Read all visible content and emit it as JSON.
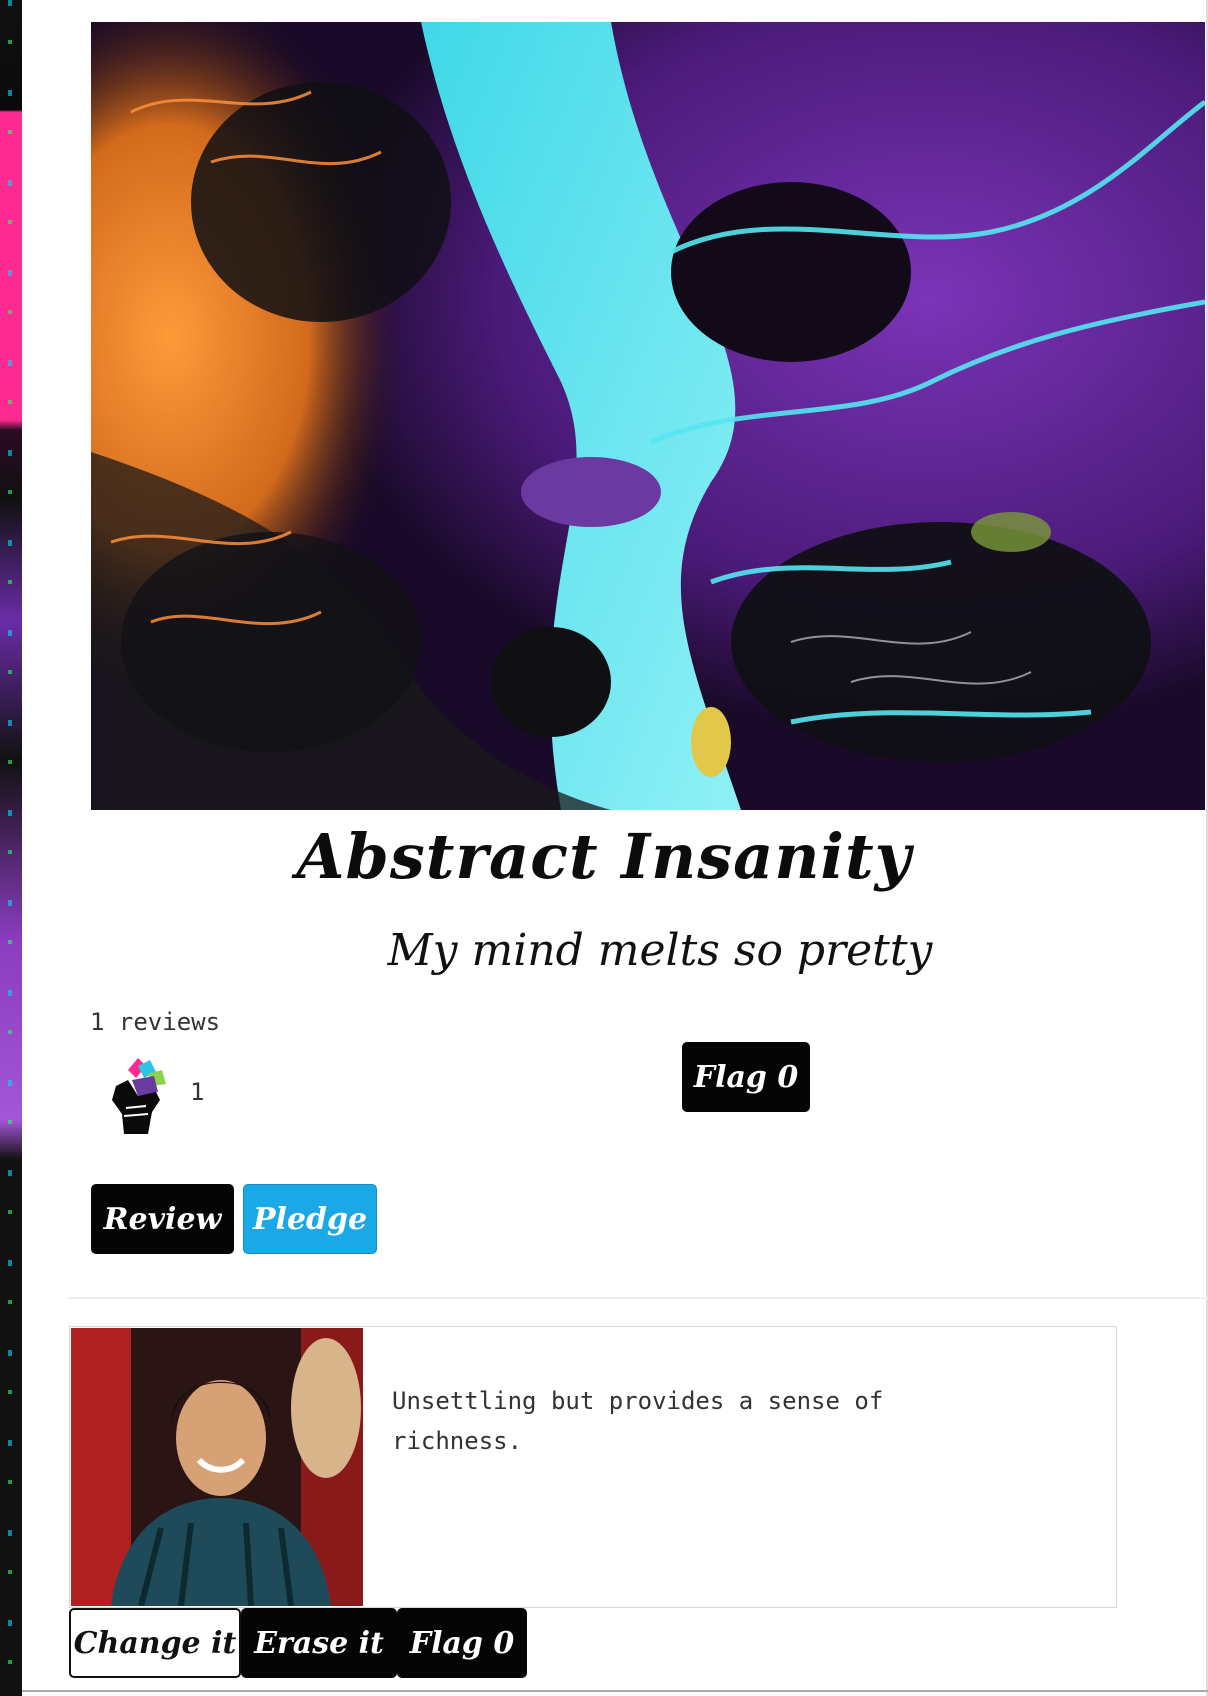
{
  "artwork": {
    "image_icon": "abstract-fluid-painting",
    "title": "Abstract Insanity",
    "subtitle": "My mind melts so pretty"
  },
  "stats": {
    "reviews_label": "1 reviews",
    "fist_icon": "raised-fist-icon",
    "fist_count": "1"
  },
  "actions": {
    "flag_label": "Flag 0",
    "review_label": "Review",
    "pledge_label": "Pledge"
  },
  "review": {
    "avatar_icon": "reviewer-avatar",
    "text": "Unsettling but provides a sense of richness.",
    "change_label": "Change it",
    "erase_label": "Erase it",
    "flag_label": "Flag 0"
  },
  "colors": {
    "pledge_blue": "#1aa8e6",
    "button_dark": "#050505",
    "accent_cyan": "#4de3ee",
    "accent_purple": "#5a2388",
    "accent_orange": "#f08a2c"
  }
}
